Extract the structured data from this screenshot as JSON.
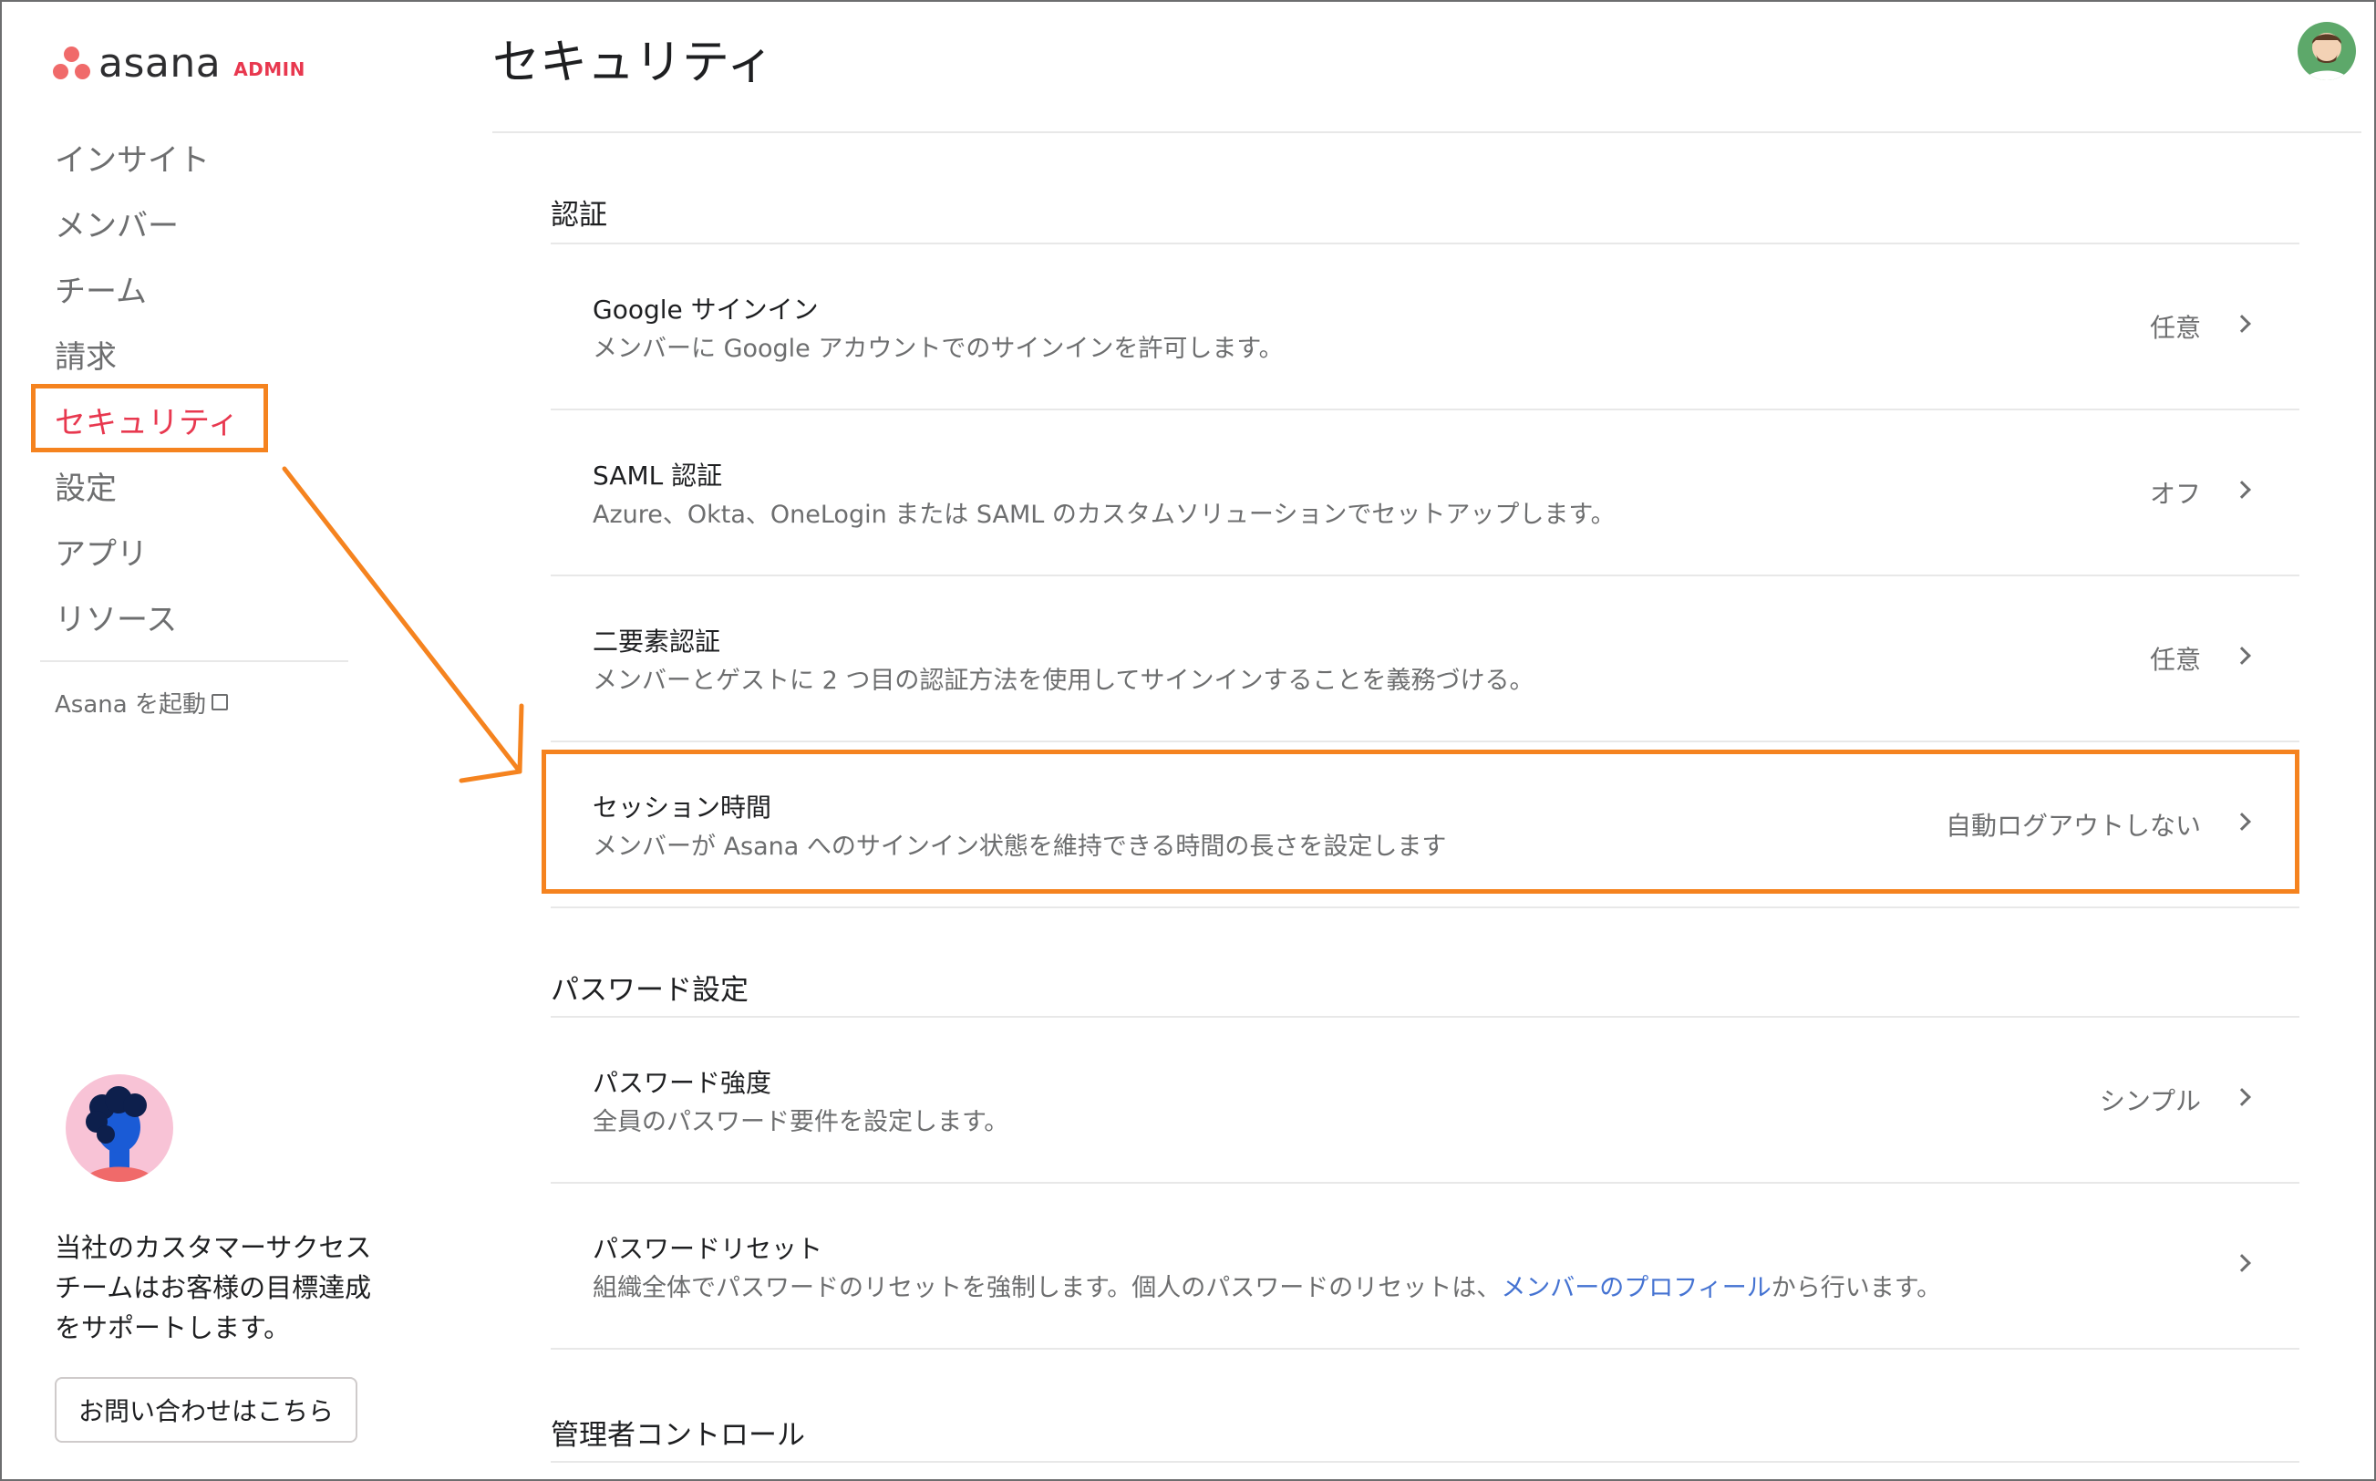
{
  "brand": {
    "wordmark": "asana",
    "admin_label": "ADMIN"
  },
  "sidebar": {
    "items": [
      {
        "label": "インサイト",
        "active": false
      },
      {
        "label": "メンバー",
        "active": false
      },
      {
        "label": "チーム",
        "active": false
      },
      {
        "label": "請求",
        "active": false
      },
      {
        "label": "セキュリティ",
        "active": true
      },
      {
        "label": "設定",
        "active": false
      },
      {
        "label": "アプリ",
        "active": false
      },
      {
        "label": "リソース",
        "active": false
      }
    ],
    "launch_label": "Asana を起動",
    "support_text": "当社のカスタマーサクセスチームはお客様の目標達成をサポートします。",
    "contact_button": "お問い合わせはこちら"
  },
  "page": {
    "title": "セキュリティ"
  },
  "sections": [
    {
      "heading": "認証",
      "rows": [
        {
          "title": "Google サインイン",
          "description": "メンバーに Google アカウントでのサインインを許可します。",
          "value": "任意"
        },
        {
          "title": "SAML 認証",
          "description": "Azure、Okta、OneLogin または SAML のカスタムソリューションでセットアップします。",
          "value": "オフ"
        },
        {
          "title": "二要素認証",
          "description": "メンバーとゲストに 2 つ目の認証方法を使用してサインインすることを義務づける。",
          "value": "任意"
        },
        {
          "title": "セッション時間",
          "description": "メンバーが Asana へのサインイン状態を維持できる時間の長さを設定します",
          "value": "自動ログアウトしない"
        }
      ]
    },
    {
      "heading": "パスワード設定",
      "rows": [
        {
          "title": "パスワード強度",
          "description": "全員のパスワード要件を設定します。",
          "value": "シンプル"
        },
        {
          "title": "パスワードリセット",
          "description_before": "組織全体でパスワードのリセットを強制します。個人のパスワードのリセットは、",
          "description_link": "メンバーのプロフィール",
          "description_after": "から行います。",
          "value": ""
        }
      ]
    },
    {
      "heading": "管理者コントロール",
      "rows": []
    }
  ],
  "colors": {
    "brand": "#f06a6a",
    "active_nav": "#e8384f",
    "highlight": "#f5831f",
    "link": "#4573d2",
    "muted_text": "#6d6e6f"
  },
  "icons": [
    "asana-logo-icon",
    "external-link-icon",
    "chevron-right-icon",
    "user-avatar-icon",
    "support-avatar-icon"
  ]
}
